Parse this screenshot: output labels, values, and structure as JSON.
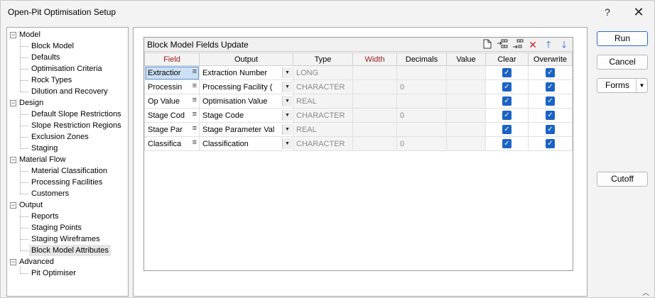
{
  "window": {
    "title": "Open-Pit Optimisation Setup",
    "help": "?",
    "close": "✕"
  },
  "tree": {
    "groups": [
      {
        "label": "Model",
        "expander": "−",
        "items": [
          "Block Model",
          "Defaults",
          "Optimisation Criteria",
          "Rock Types",
          "Dilution and Recovery"
        ]
      },
      {
        "label": "Design",
        "expander": "−",
        "items": [
          "Default Slope Restrictions",
          "Slope Restriction Regions",
          "Exclusion Zones",
          "Staging"
        ]
      },
      {
        "label": "Material Flow",
        "expander": "−",
        "items": [
          "Material Classification",
          "Processing Facilities",
          "Customers"
        ]
      },
      {
        "label": "Output",
        "expander": "−",
        "items": [
          "Reports",
          "Staging Points",
          "Staging Wireframes",
          "Block Model Attributes"
        ]
      },
      {
        "label": "Advanced",
        "expander": "−",
        "items": [
          "Pit Optimiser"
        ]
      }
    ],
    "selected": "Block Model Attributes"
  },
  "grid": {
    "title": "Block Model Fields Update",
    "toolbar_icons": [
      "new-page-icon",
      "insert-row-icon",
      "append-row-icon",
      "delete-icon",
      "move-up-icon",
      "move-down-icon"
    ],
    "columns": [
      "Field",
      "Output",
      "Type",
      "Width",
      "Decimals",
      "Value",
      "Clear",
      "Overwrite"
    ],
    "rows": [
      {
        "field": "Extractior",
        "output": "Extraction Number",
        "type": "LONG",
        "width": "",
        "decimals": "",
        "value": "",
        "clear": true,
        "overwrite": true
      },
      {
        "field": "Processin",
        "output": "Processing Facility (",
        "type": "CHARACTER",
        "width": "",
        "decimals": "0",
        "value": "",
        "clear": true,
        "overwrite": true
      },
      {
        "field": "Op Value",
        "output": "Optimisation Value",
        "type": "REAL",
        "width": "",
        "decimals": "",
        "value": "",
        "clear": true,
        "overwrite": true
      },
      {
        "field": "Stage Cod",
        "output": "Stage Code",
        "type": "CHARACTER",
        "width": "",
        "decimals": "0",
        "value": "",
        "clear": true,
        "overwrite": true
      },
      {
        "field": "Stage Par",
        "output": "Stage Parameter Val",
        "type": "REAL",
        "width": "",
        "decimals": "",
        "value": "",
        "clear": true,
        "overwrite": true
      },
      {
        "field": "Classifica",
        "output": "Classification",
        "type": "CHARACTER",
        "width": "",
        "decimals": "0",
        "value": "",
        "clear": true,
        "overwrite": true
      }
    ]
  },
  "buttons": {
    "run": "Run",
    "cancel": "Cancel",
    "forms": "Forms",
    "cutoff": "Cutoff"
  },
  "colors": {
    "accent": "#1a63c4",
    "header_red": "#9a1b1b",
    "selection": "#cce0f5"
  }
}
